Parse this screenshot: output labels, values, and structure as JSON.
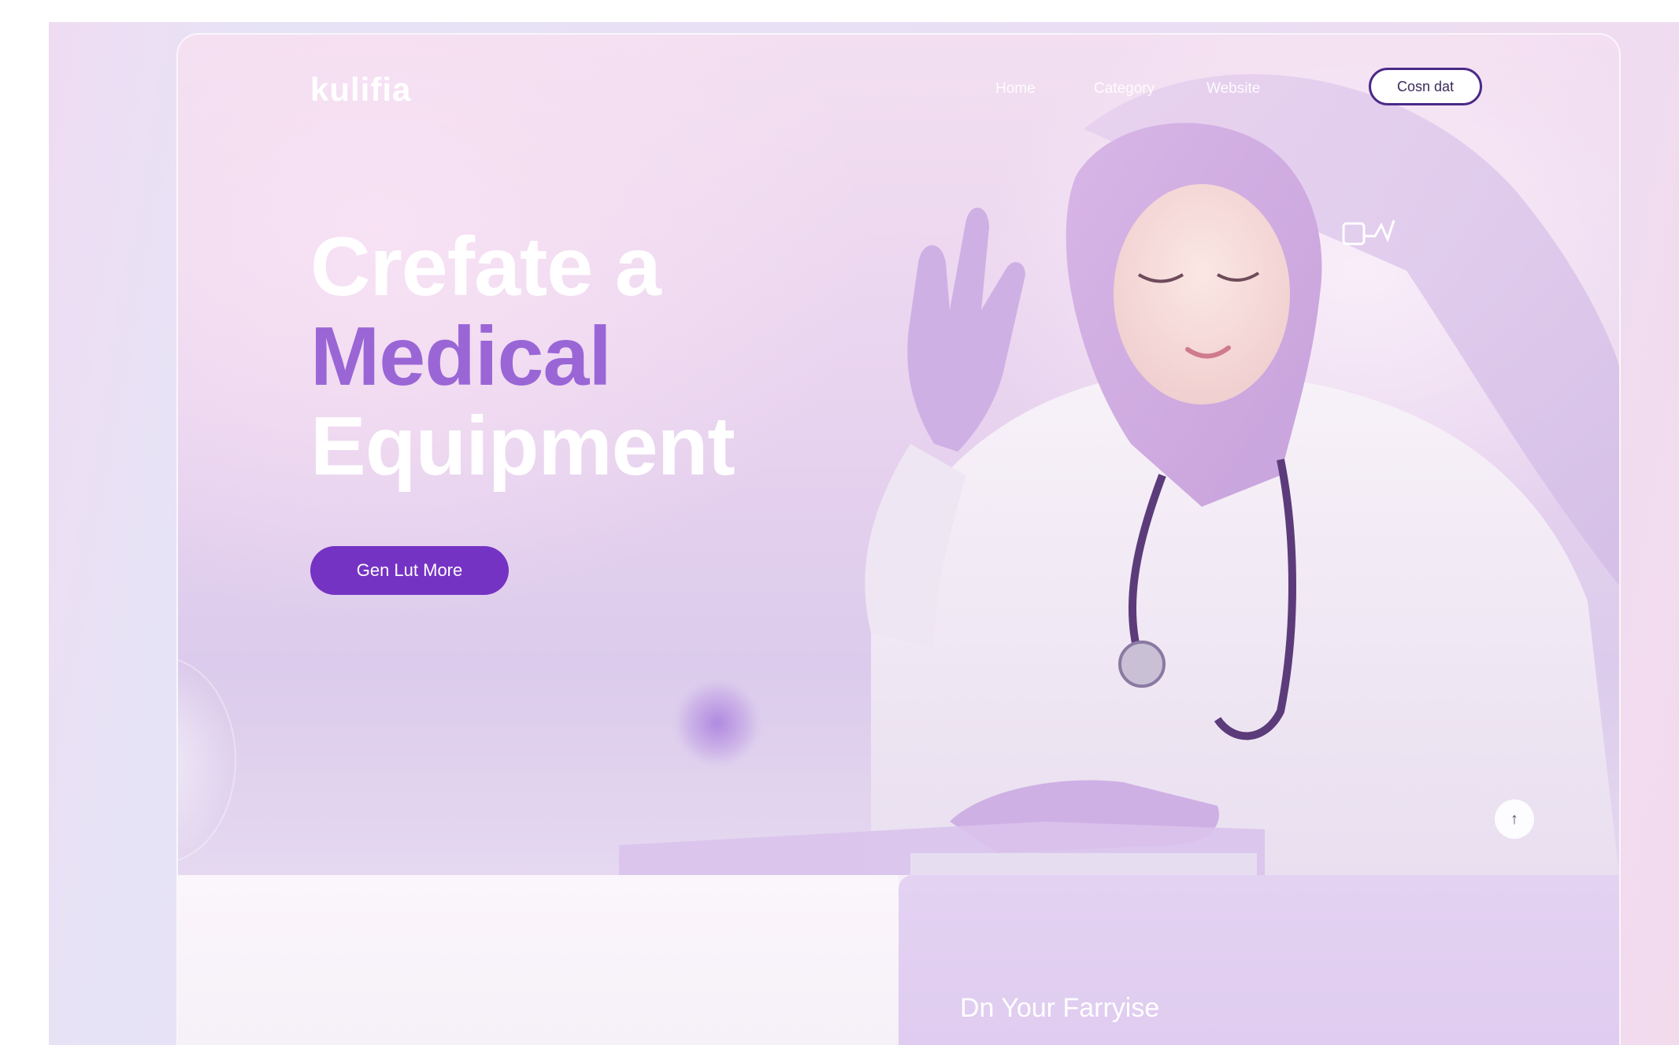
{
  "brand": {
    "logo": "kulifia"
  },
  "nav": {
    "items": [
      "Home",
      "Category",
      "Website"
    ]
  },
  "header": {
    "cta_label": "Cosn dat"
  },
  "hero": {
    "line1": "Crefate a",
    "line2": "Medical",
    "line3": "Equipment",
    "button_label": "Gen Lut More"
  },
  "controls": {
    "next_symbol": "↑"
  },
  "bottom": {
    "title": "Dn Your Farryise"
  },
  "colors": {
    "accent": "#7533c4",
    "accent_text": "#9a66d6",
    "background": "#efdcf2"
  }
}
